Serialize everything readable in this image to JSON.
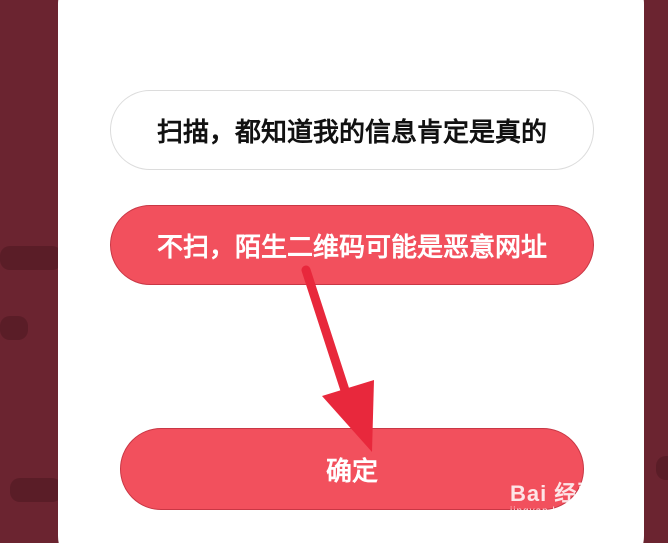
{
  "dialog": {
    "option_scan": "扫描，都知道我的信息肯定是真的",
    "option_no_scan": "不扫，陌生二维码可能是恶意网址",
    "confirm_label": "确定"
  },
  "watermark": {
    "logo": "Bai 经验",
    "url": "jingyan.baidu.com"
  },
  "colors": {
    "backdrop": "#6b2430",
    "accent": "#f2505d",
    "arrow": "#e8283c"
  }
}
